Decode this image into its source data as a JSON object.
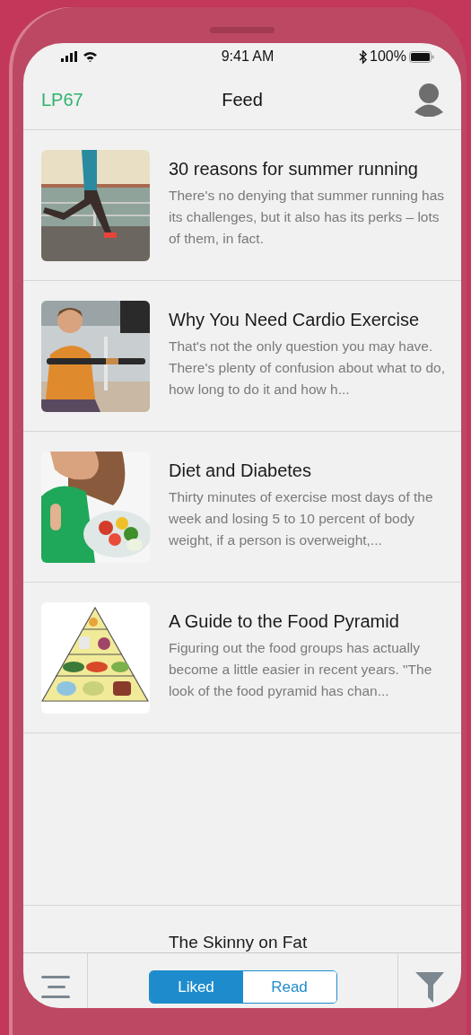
{
  "status_bar": {
    "time": "9:41 AM",
    "battery": "100%"
  },
  "header": {
    "logo": "LP67",
    "title": "Feed"
  },
  "articles": [
    {
      "title": "30 reasons for summer running",
      "summary": "There's no denying that summer running has its challenges, but it also has its perks – lots of them, in fact."
    },
    {
      "title": "Why You Need Cardio Exercise",
      "summary": "That's not the only question you may have. There's plenty of confusion about what to do, how long to do it and how h..."
    },
    {
      "title": "Diet and Diabetes",
      "summary": "Thirty minutes of exercise most days of the week and losing 5 to 10 percent of body weight, if a person is overweight,..."
    },
    {
      "title": "A Guide to the Food Pyramid",
      "summary": "Figuring out the food groups has actually become a little easier in recent years. \"The look of the food pyramid has chan..."
    }
  ],
  "partial_article": {
    "title": "The Skinny on Fat"
  },
  "segments": [
    {
      "label": "Liked",
      "selected": true
    },
    {
      "label": "Read",
      "selected": false
    }
  ]
}
